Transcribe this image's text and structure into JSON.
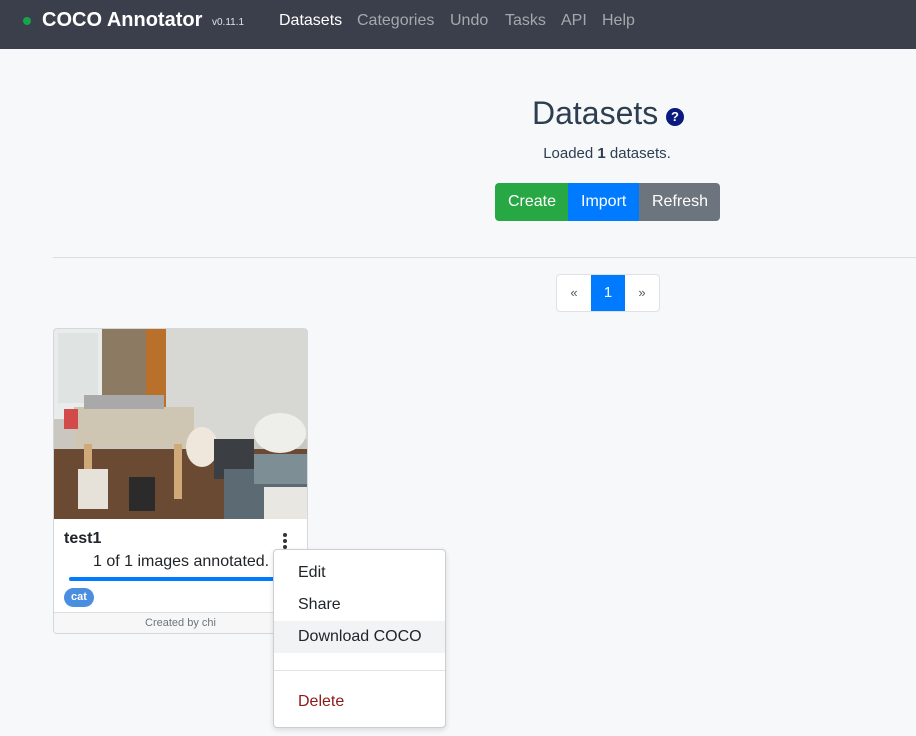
{
  "navbar": {
    "brand": "COCO Annotator",
    "version": "v0.11.1",
    "items": [
      "Datasets",
      "Categories",
      "Undo",
      "Tasks",
      "API",
      "Help"
    ],
    "active": "Datasets"
  },
  "page": {
    "title": "Datasets",
    "help_icon": "?",
    "loaded_prefix": "Loaded ",
    "loaded_count": "1",
    "loaded_suffix": " datasets."
  },
  "actions": {
    "create": "Create",
    "import": "Import",
    "refresh": "Refresh"
  },
  "pagination": {
    "prev": "«",
    "current": "1",
    "next": "»"
  },
  "dataset": {
    "name": "test1",
    "annotated_text": "1 of 1 images annotated.",
    "progress": 1.0,
    "category": "cat",
    "created_by": "Created by chi"
  },
  "menu": {
    "edit": "Edit",
    "share": "Share",
    "download": "Download COCO",
    "delete": "Delete"
  },
  "colors": {
    "navbar": "#3a3f4b",
    "create": "#28a745",
    "import": "#007bff",
    "refresh": "#6c757d",
    "delete": "#8b1a1a"
  }
}
